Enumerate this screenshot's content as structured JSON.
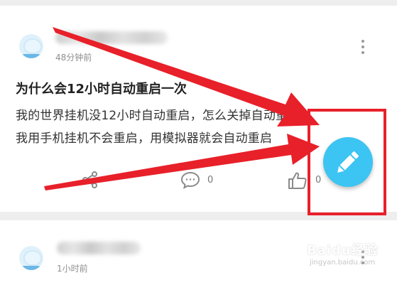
{
  "post1": {
    "time": "48分钟前",
    "title": "为什么会12小时自动重启一次",
    "body_line1": "我的世界挂机没12小时自动重启，怎么关掉自动重启，",
    "body_line2": "我用手机挂机不会重启，用模拟器就会自动重启",
    "comment_count": "0",
    "like_count": "0"
  },
  "post2": {
    "time": "1小时前"
  },
  "fab": {
    "icon": "pencil-icon",
    "color": "#3cc4f2"
  },
  "annotations": {
    "arrow_color": "#e8202a",
    "box_color": "#e8202a"
  },
  "watermark": {
    "text": "Baidu经验",
    "url": "jingyan.baidu.com"
  }
}
